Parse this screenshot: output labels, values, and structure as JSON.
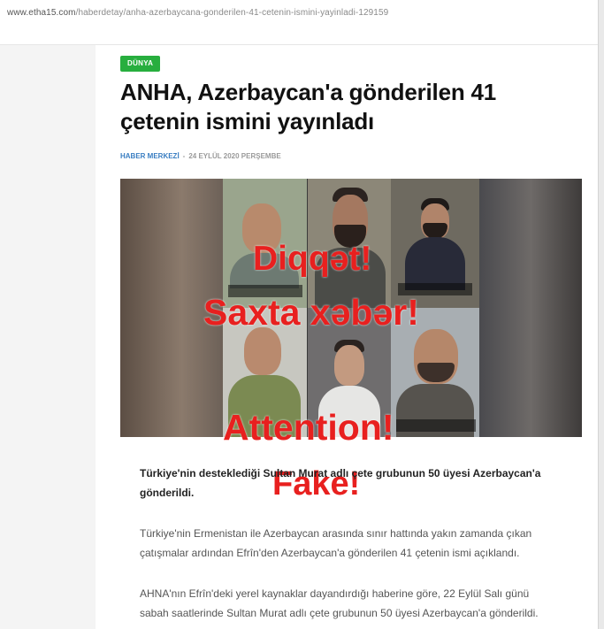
{
  "browser": {
    "url_domain": "www.etha15.com",
    "url_path": "/haberdetay/anha-azerbaycana-gonderilen-41-cetenin-ismini-yayinladi-129159"
  },
  "article": {
    "category": "DÜNYA",
    "title": "ANHA, Azerbaycan'a gönderilen 41 çetenin ismini yayınladı",
    "author": "HABER MERKEZİ",
    "separator": "-",
    "date": "24 EYLÜL 2020 PERŞEMBE",
    "paragraphs": [
      "Türkiye'nin desteklediği Sultan Murat adlı çete grubunun 50 üyesi Azerbaycan'a gönderildi.",
      "Türkiye'nin Ermenistan ile Azerbaycan arasında sınır hattında yakın zamanda çıkan çatışmalar ardından Efrîn'den Azerbaycan'a gönderilen 41 çetenin ismi açıklandı.",
      "AHNA'nın Efrîn'deki yerel kaynaklar dayandırdığı haberine göre, 22 Eylül Salı günü sabah saatlerinde Sultan Murat adlı çete grubunun 50 üyesi Azerbaycan'a gönderildi."
    ]
  },
  "overlay": {
    "line1": "Diqqət!",
    "line2": "Saxta xəbər!",
    "line3": "Attention!",
    "line4": "Fake!",
    "color": "#e8201f"
  },
  "colors": {
    "badge": "#27ae3e",
    "author": "#3a7ec2"
  }
}
